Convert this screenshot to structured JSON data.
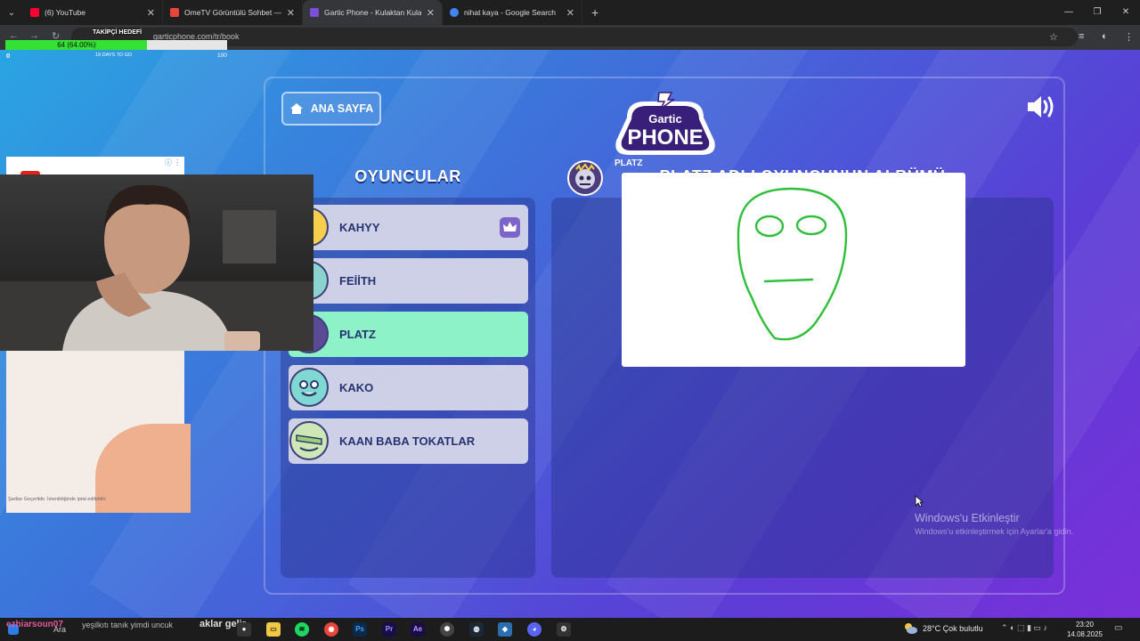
{
  "browser": {
    "tabs": [
      {
        "title": "(6) YouTube",
        "color": "#ff0033",
        "active": false
      },
      {
        "title": "OmeTV Görüntülü Sohbet — O",
        "color": "#e8453c",
        "active": false
      },
      {
        "title": "Gartic Phone - Kulaktan Kulağa",
        "color": "#7b4fd6",
        "active": true
      },
      {
        "title": "nihat kaya - Google Search",
        "color": "#4285f4",
        "active": false
      }
    ],
    "url": "garticphone.com/tr/book"
  },
  "goal": {
    "title": "TAKİPÇİ HEDEFİ",
    "progress_text": "64 (64.00%)",
    "progress": 0.64,
    "min": "0",
    "days": "19 DAYS TO GO",
    "max": "100"
  },
  "game": {
    "home_button": "ANA SAYFA",
    "logo_top": "Gartic",
    "logo_bottom": "PHONE",
    "players_heading": "OYUNCULAR",
    "album_heading": "PLATZ ADLI OYUNCUNUN ALBÜMÜ",
    "players": [
      {
        "name": "KAHYY",
        "host": true,
        "active": false
      },
      {
        "name": "FEİİTH",
        "host": false,
        "active": false
      },
      {
        "name": "PLATZ",
        "host": false,
        "active": true
      },
      {
        "name": "KAKO",
        "host": false,
        "active": false
      },
      {
        "name": "KAAN BABA TOKATLAR",
        "host": false,
        "active": false
      }
    ],
    "album_player": "PLATZ"
  },
  "windows": {
    "activate_title": "Windows'u Etkinleştir",
    "activate_sub": "Windows'u etkinleştirmek için Ayarlar'a gidin."
  },
  "ad": {
    "footer": "Şartlar Geçerlidir. İstenildiğinde iptal edilebilir."
  },
  "chat": {
    "user": "ezhiarsoun07",
    "message": "yeşilkıtı tanık yimdi uncuk",
    "overlay": "aklar gelir"
  },
  "taskbar": {
    "search": "Ara",
    "weather": "28°C  Çok bulutlu",
    "time": "23:20",
    "date": "14.08.2025"
  },
  "colors": {
    "active_player": "#8ef2c9",
    "player": "#ced0e8",
    "drawing_stroke": "#2fbf3a"
  }
}
